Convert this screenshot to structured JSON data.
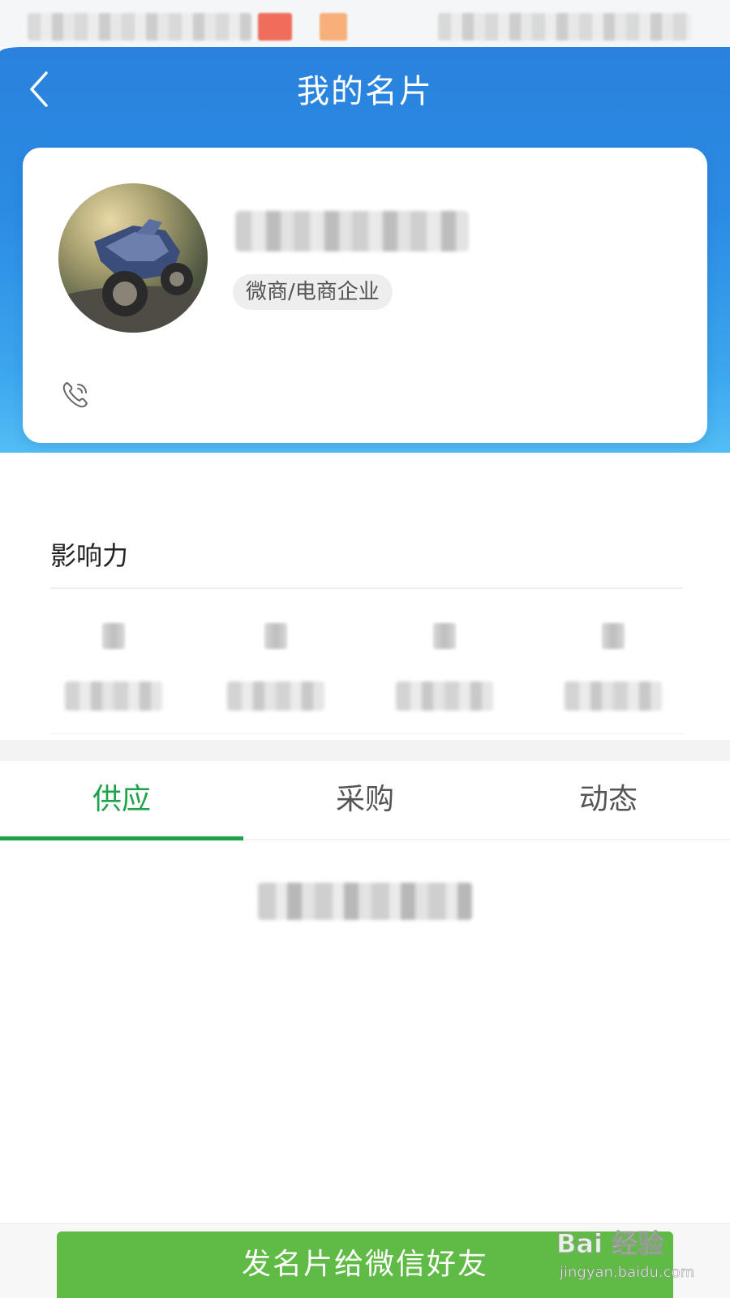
{
  "header": {
    "title": "我的名片",
    "back_icon": "chevron-left-icon",
    "background_color": "#2b8be3"
  },
  "card": {
    "category_tag": "微商/电商企业",
    "phone_icon": "phone-call-icon"
  },
  "influence": {
    "title": "影响力"
  },
  "tabs": [
    {
      "label": "供应",
      "active": true
    },
    {
      "label": "采购",
      "active": false
    },
    {
      "label": "动态",
      "active": false
    }
  ],
  "accent_color": "#1fa34a",
  "bottom": {
    "share_button_label": "发名片给微信好友",
    "share_button_color": "#5fbb46"
  },
  "watermark": {
    "brand": "Bai 经验",
    "url": "jingyan.baidu.com"
  }
}
